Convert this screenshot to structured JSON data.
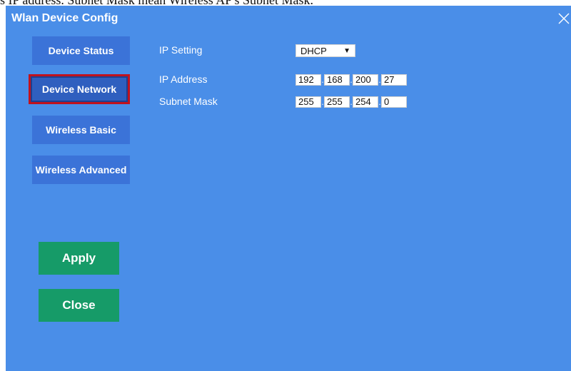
{
  "caption": "s IP address. Subnet Mask mean Wireless AP's Subnet Mask.",
  "dialog": {
    "title": "Wlan Device Config",
    "close_icon": "close-icon"
  },
  "nav": {
    "device_status": "Device Status",
    "device_network": "Device Network",
    "wireless_basic": "Wireless Basic",
    "wireless_advanced": "Wireless Advanced",
    "selected": "Device Network"
  },
  "actions": {
    "apply": "Apply",
    "close": "Close"
  },
  "form": {
    "ip_setting_label": "IP Setting",
    "ip_setting_value": "DHCP",
    "ip_address_label": "IP Address",
    "ip_address": [
      "192",
      "168",
      "200",
      "27"
    ],
    "subnet_mask_label": "Subnet Mask",
    "subnet_mask": [
      "255",
      "255",
      "254",
      "0"
    ]
  },
  "colors": {
    "panel_bg": "#4a8ee8",
    "nav_button": "#3b73d8",
    "selected_border": "#c0121e",
    "action_button": "#169b68"
  }
}
